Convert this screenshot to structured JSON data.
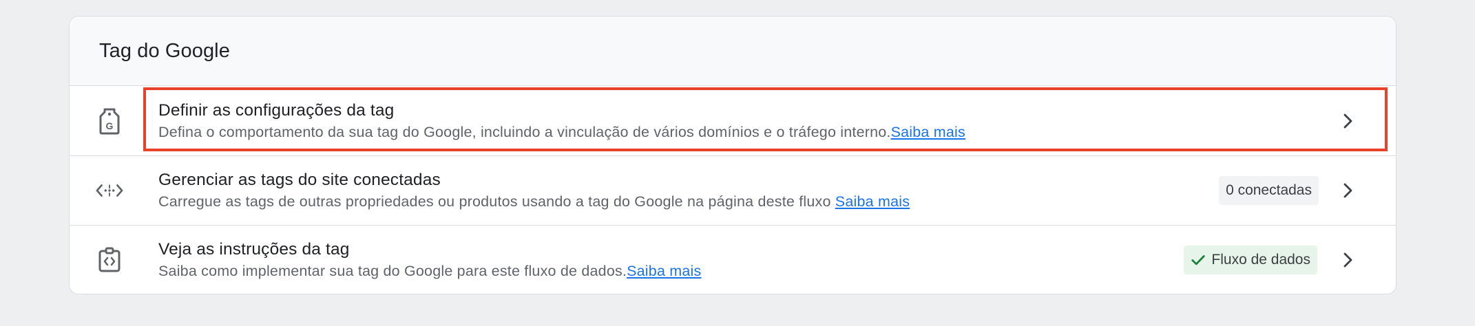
{
  "card": {
    "title": "Tag do Google"
  },
  "rows": [
    {
      "icon": "google-tag-icon",
      "title": "Definir as configurações da tag",
      "description": "Defina o comportamento da sua tag do Google, incluindo a vinculação de vários domínios e o tráfego interno.",
      "link": "Saiba mais",
      "highlighted": true
    },
    {
      "icon": "code-arrows-icon",
      "title": "Gerenciar as tags do site conectadas",
      "description": "Carregue as tags de outras propriedades ou produtos usando a tag do Google na página deste fluxo ",
      "link": "Saiba mais",
      "badge": "0 conectadas"
    },
    {
      "icon": "code-clipboard-icon",
      "title": "Veja as instruções da tag",
      "description": "Saiba como implementar sua tag do Google para este fluxo de dados.",
      "link": "Saiba mais",
      "badge": "Fluxo de dados",
      "badge_icon": "check-icon"
    }
  ],
  "colors": {
    "background": "#eeeff1",
    "card": "#ffffff",
    "header": "#f8f9fa",
    "link": "#1a73e8",
    "highlight_border": "#e8432a",
    "success_badge": "#e6f4ea",
    "success_check": "#188038"
  }
}
